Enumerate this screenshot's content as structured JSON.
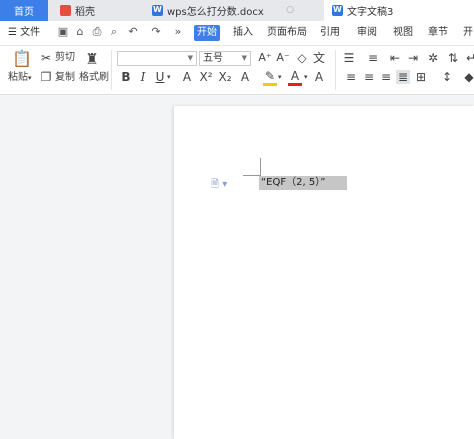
{
  "tabs": {
    "home": "首页",
    "daoke": "稻壳",
    "wps": "wps怎么打分数.docx",
    "doc3": "文字文稿3"
  },
  "menu": {
    "file": "文件",
    "start": "开始",
    "insert": "插入",
    "page_layout": "页面布局",
    "reference": "引用",
    "review": "审阅",
    "view": "视图",
    "chapter": "章节",
    "more": "开"
  },
  "ribbon": {
    "paste": "粘贴",
    "cut": "剪切",
    "copy": "复制",
    "format_painter": "格式刷",
    "font_name": "",
    "font_size": "五号"
  },
  "document": {
    "field_code": "“EQF（2, 5）”"
  },
  "colors": {
    "accent": "#3d7ee8",
    "highlight": "#f5c518",
    "font_color": "#e2231a"
  }
}
